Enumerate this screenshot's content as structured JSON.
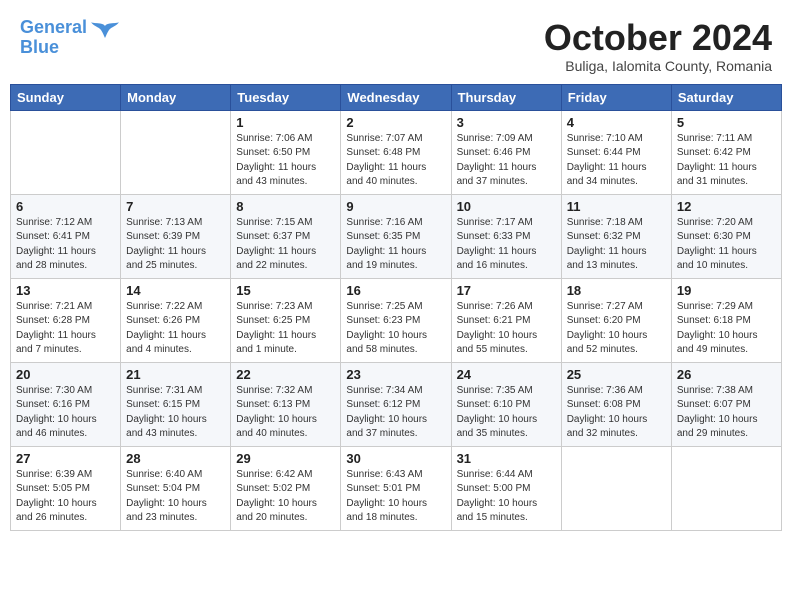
{
  "header": {
    "logo_line1": "General",
    "logo_line2": "Blue",
    "month_title": "October 2024",
    "subtitle": "Buliga, Ialomita County, Romania"
  },
  "days_of_week": [
    "Sunday",
    "Monday",
    "Tuesday",
    "Wednesday",
    "Thursday",
    "Friday",
    "Saturday"
  ],
  "weeks": [
    [
      {
        "day": "",
        "info": ""
      },
      {
        "day": "",
        "info": ""
      },
      {
        "day": "1",
        "info": "Sunrise: 7:06 AM\nSunset: 6:50 PM\nDaylight: 11 hours and 43 minutes."
      },
      {
        "day": "2",
        "info": "Sunrise: 7:07 AM\nSunset: 6:48 PM\nDaylight: 11 hours and 40 minutes."
      },
      {
        "day": "3",
        "info": "Sunrise: 7:09 AM\nSunset: 6:46 PM\nDaylight: 11 hours and 37 minutes."
      },
      {
        "day": "4",
        "info": "Sunrise: 7:10 AM\nSunset: 6:44 PM\nDaylight: 11 hours and 34 minutes."
      },
      {
        "day": "5",
        "info": "Sunrise: 7:11 AM\nSunset: 6:42 PM\nDaylight: 11 hours and 31 minutes."
      }
    ],
    [
      {
        "day": "6",
        "info": "Sunrise: 7:12 AM\nSunset: 6:41 PM\nDaylight: 11 hours and 28 minutes."
      },
      {
        "day": "7",
        "info": "Sunrise: 7:13 AM\nSunset: 6:39 PM\nDaylight: 11 hours and 25 minutes."
      },
      {
        "day": "8",
        "info": "Sunrise: 7:15 AM\nSunset: 6:37 PM\nDaylight: 11 hours and 22 minutes."
      },
      {
        "day": "9",
        "info": "Sunrise: 7:16 AM\nSunset: 6:35 PM\nDaylight: 11 hours and 19 minutes."
      },
      {
        "day": "10",
        "info": "Sunrise: 7:17 AM\nSunset: 6:33 PM\nDaylight: 11 hours and 16 minutes."
      },
      {
        "day": "11",
        "info": "Sunrise: 7:18 AM\nSunset: 6:32 PM\nDaylight: 11 hours and 13 minutes."
      },
      {
        "day": "12",
        "info": "Sunrise: 7:20 AM\nSunset: 6:30 PM\nDaylight: 11 hours and 10 minutes."
      }
    ],
    [
      {
        "day": "13",
        "info": "Sunrise: 7:21 AM\nSunset: 6:28 PM\nDaylight: 11 hours and 7 minutes."
      },
      {
        "day": "14",
        "info": "Sunrise: 7:22 AM\nSunset: 6:26 PM\nDaylight: 11 hours and 4 minutes."
      },
      {
        "day": "15",
        "info": "Sunrise: 7:23 AM\nSunset: 6:25 PM\nDaylight: 11 hours and 1 minute."
      },
      {
        "day": "16",
        "info": "Sunrise: 7:25 AM\nSunset: 6:23 PM\nDaylight: 10 hours and 58 minutes."
      },
      {
        "day": "17",
        "info": "Sunrise: 7:26 AM\nSunset: 6:21 PM\nDaylight: 10 hours and 55 minutes."
      },
      {
        "day": "18",
        "info": "Sunrise: 7:27 AM\nSunset: 6:20 PM\nDaylight: 10 hours and 52 minutes."
      },
      {
        "day": "19",
        "info": "Sunrise: 7:29 AM\nSunset: 6:18 PM\nDaylight: 10 hours and 49 minutes."
      }
    ],
    [
      {
        "day": "20",
        "info": "Sunrise: 7:30 AM\nSunset: 6:16 PM\nDaylight: 10 hours and 46 minutes."
      },
      {
        "day": "21",
        "info": "Sunrise: 7:31 AM\nSunset: 6:15 PM\nDaylight: 10 hours and 43 minutes."
      },
      {
        "day": "22",
        "info": "Sunrise: 7:32 AM\nSunset: 6:13 PM\nDaylight: 10 hours and 40 minutes."
      },
      {
        "day": "23",
        "info": "Sunrise: 7:34 AM\nSunset: 6:12 PM\nDaylight: 10 hours and 37 minutes."
      },
      {
        "day": "24",
        "info": "Sunrise: 7:35 AM\nSunset: 6:10 PM\nDaylight: 10 hours and 35 minutes."
      },
      {
        "day": "25",
        "info": "Sunrise: 7:36 AM\nSunset: 6:08 PM\nDaylight: 10 hours and 32 minutes."
      },
      {
        "day": "26",
        "info": "Sunrise: 7:38 AM\nSunset: 6:07 PM\nDaylight: 10 hours and 29 minutes."
      }
    ],
    [
      {
        "day": "27",
        "info": "Sunrise: 6:39 AM\nSunset: 5:05 PM\nDaylight: 10 hours and 26 minutes."
      },
      {
        "day": "28",
        "info": "Sunrise: 6:40 AM\nSunset: 5:04 PM\nDaylight: 10 hours and 23 minutes."
      },
      {
        "day": "29",
        "info": "Sunrise: 6:42 AM\nSunset: 5:02 PM\nDaylight: 10 hours and 20 minutes."
      },
      {
        "day": "30",
        "info": "Sunrise: 6:43 AM\nSunset: 5:01 PM\nDaylight: 10 hours and 18 minutes."
      },
      {
        "day": "31",
        "info": "Sunrise: 6:44 AM\nSunset: 5:00 PM\nDaylight: 10 hours and 15 minutes."
      },
      {
        "day": "",
        "info": ""
      },
      {
        "day": "",
        "info": ""
      }
    ]
  ]
}
